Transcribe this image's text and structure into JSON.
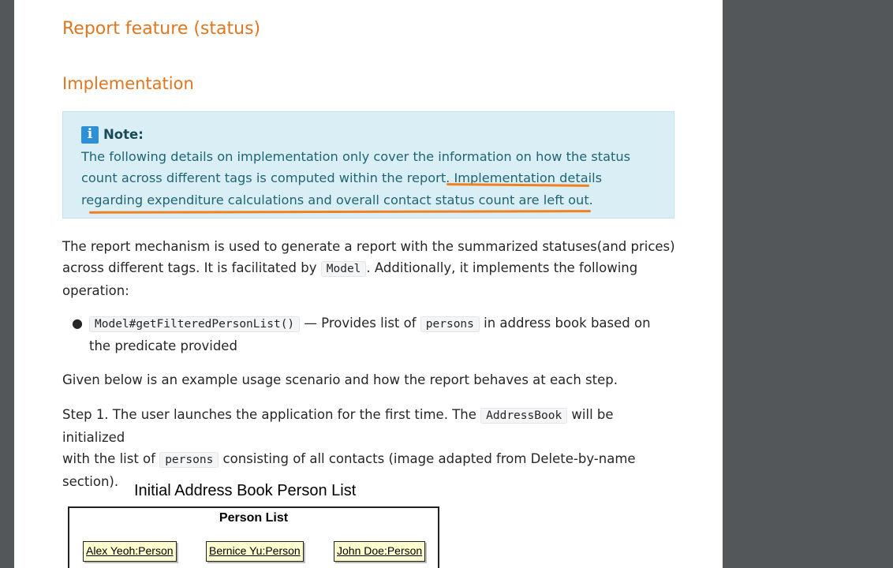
{
  "document": {
    "section_title": "Report feature (status)",
    "subsection_title": "Implementation",
    "note": {
      "title": "Note:",
      "line1": "The following details on implementation only cover the information on how the status",
      "line2a": "count across different tags is computed within the report. ",
      "line2b": "Implementation details",
      "line3": "regarding expenditure calculations and overall contact status count are left out."
    },
    "para1": {
      "t1": "The report mechanism is used to generate a report with the summarized statuses(and prices)",
      "t2": "across different tags. It is facilitated by ",
      "code1": "Model",
      "t3": ". Additionally, it implements the following",
      "t4": "operation:"
    },
    "operations": [
      {
        "code": "Model#getFilteredPersonList()",
        "t1": " — Provides list of ",
        "code2": "persons",
        "t2": " in address book based on",
        "t3": "the predicate provided"
      }
    ],
    "para2": "Given below is an example usage scenario and how the report behaves at each step.",
    "step1": {
      "t1": "Step 1. The user launches the application for the first time. The ",
      "code1": "AddressBook",
      "t2": " will be initialized",
      "t3": "with the list of ",
      "code2": "persons",
      "t4": " consisting of all contacts (image adapted from Delete-by-name",
      "t5": "section)."
    },
    "diagram": {
      "title": "Initial Address Book Person List",
      "box_label": "Person List",
      "objects": [
        "Alex Yeoh:Person",
        "Bernice Yu:Person",
        "John Doe:Person"
      ]
    }
  },
  "colors": {
    "heading": "#e07620",
    "note_bg": "#d9eff5",
    "note_text": "#1f6574",
    "annotation": "#f08020",
    "viewer_bg": "#54575a"
  },
  "icons": {
    "note_icon": "info-icon"
  }
}
